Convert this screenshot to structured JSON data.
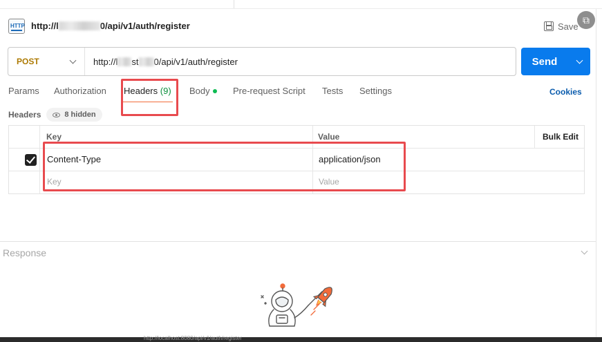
{
  "title_bar": {
    "url_prefix": "http://l",
    "url_suffix": "0/api/v1/auth/register",
    "save_label": "Save"
  },
  "request": {
    "method": "POST",
    "url_prefix": "http://l",
    "url_mid": "st",
    "url_suffix": "0/api/v1/auth/register",
    "send_label": "Send"
  },
  "tabs": {
    "params": "Params",
    "authorization": "Authorization",
    "headers": "Headers",
    "headers_count": "(9)",
    "body": "Body",
    "prerequest": "Pre-request Script",
    "tests": "Tests",
    "settings": "Settings",
    "cookies": "Cookies"
  },
  "headers_section": {
    "label": "Headers",
    "hidden": "8 hidden"
  },
  "table": {
    "col_key": "Key",
    "col_value": "Value",
    "bulk_edit": "Bulk Edit",
    "rows": [
      {
        "key": "Content-Type",
        "value": "application/json",
        "checked": true
      }
    ],
    "placeholder_key": "Key",
    "placeholder_value": "Value"
  },
  "response": {
    "label": "Response"
  },
  "status_bar": {
    "text": "http://localhost:8080/api/v1/auth/register"
  },
  "colors": {
    "send": "#097bed",
    "method": "#ad7a03",
    "highlight": "#e84a4e",
    "tab_active_underline": "#f26b3a",
    "body_dot": "#0cbb52"
  }
}
